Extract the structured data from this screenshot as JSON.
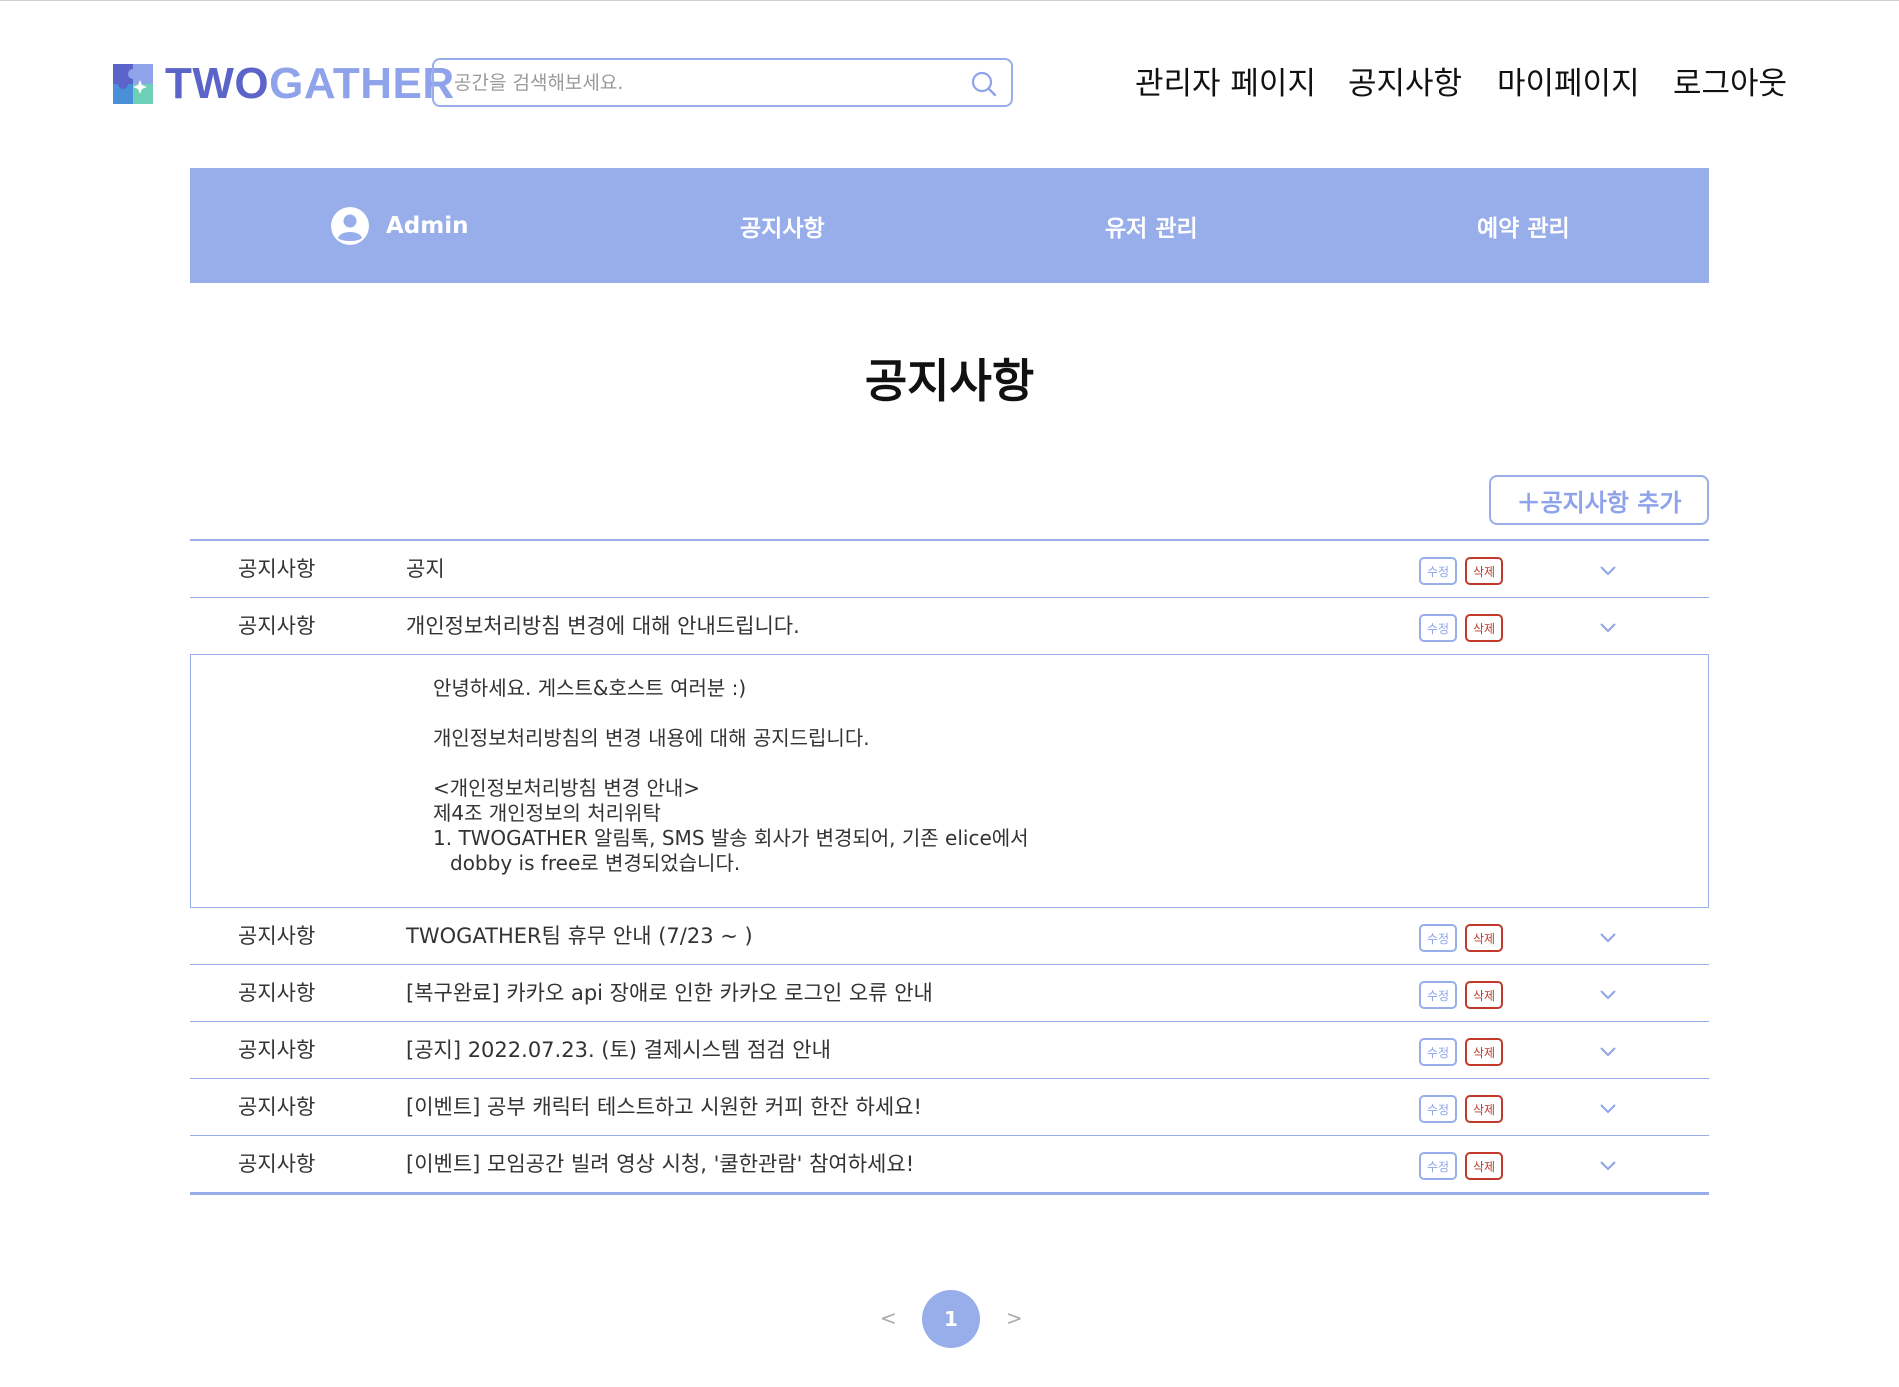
{
  "header": {
    "logo": {
      "part1": "TWO",
      "part2": "GATHER"
    },
    "search": {
      "placeholder": "공간을 검색해보세요.",
      "value": ""
    },
    "nav": [
      {
        "label": "관리자 페이지"
      },
      {
        "label": "공지사항"
      },
      {
        "label": "마이페이지"
      },
      {
        "label": "로그아웃"
      }
    ]
  },
  "admin_bar": {
    "user": "Admin",
    "menu": [
      {
        "label": "공지사항"
      },
      {
        "label": "유저 관리"
      },
      {
        "label": "예약 관리"
      }
    ]
  },
  "page_title": "공지사항",
  "add_button": "＋공지사항 추가",
  "buttons": {
    "edit": "수정",
    "delete": "삭제"
  },
  "notices": [
    {
      "category": "공지사항",
      "title": "공지"
    },
    {
      "category": "공지사항",
      "title": "개인정보처리방침 변경에 대해 안내드립니다."
    },
    {
      "category": "공지사항",
      "title": "TWOGATHER팀 휴무 안내 (7/23 ~ )"
    },
    {
      "category": "공지사항",
      "title": "[복구완료] 카카오 api 장애로 인한 카카오 로그인 오류 안내"
    },
    {
      "category": "공지사항",
      "title": "[공지] 2022.07.23. (토) 결제시스템 점검 안내"
    },
    {
      "category": "공지사항",
      "title": "[이벤트] 공부 캐릭터 테스트하고 시원한 커피 한잔 하세요!"
    },
    {
      "category": "공지사항",
      "title": "[이벤트] 모임공간 빌려 영상 시청, '쿨한관람' 참여하세요!"
    }
  ],
  "expanded_detail": {
    "greeting": "안녕하세요. 게스트&호스트 여러분 :)",
    "intro": "개인정보처리방침의 변경 내용에 대해 공지드립니다.",
    "heading": "<개인정보처리방침 변경 안내>",
    "article": "제4조 개인정보의 처리위탁",
    "item_line1": "1. TWOGATHER 알림톡, SMS 발송 회사가 변경되어, 기존 elice에서",
    "item_line2": "dobby is free로 변경되었습니다."
  },
  "pagination": {
    "prev": "<",
    "current": "1",
    "next": ">"
  },
  "colors": {
    "accent": "#98aeea",
    "brand_dark": "#5b64c8",
    "danger": "#c0392b"
  }
}
